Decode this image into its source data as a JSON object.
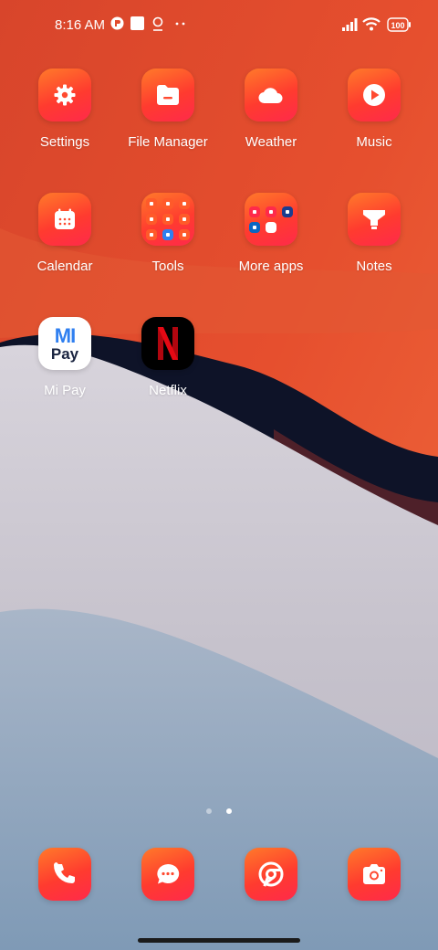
{
  "status_bar": {
    "time": "8:16 AM",
    "battery": "100",
    "icons": [
      "app-notification-icon",
      "square-notification-icon",
      "location-icon",
      "more-dots-icon",
      "signal-icon",
      "wifi-icon",
      "battery-icon"
    ]
  },
  "apps": [
    {
      "label": "Settings",
      "icon": "gear-icon"
    },
    {
      "label": "File Manager",
      "icon": "folder-icon"
    },
    {
      "label": "Weather",
      "icon": "cloud-icon"
    },
    {
      "label": "Music",
      "icon": "play-icon"
    },
    {
      "label": "Calendar",
      "icon": "calendar-icon"
    },
    {
      "label": "Tools",
      "icon": "tools-folder-icon"
    },
    {
      "label": "More apps",
      "icon": "more-apps-folder-icon"
    },
    {
      "label": "Notes",
      "icon": "notes-icon"
    },
    {
      "label": "Mi Pay",
      "icon": "mipay-icon",
      "icon_text": "Pay",
      "icon_top": "MI"
    },
    {
      "label": "Netflix",
      "icon": "netflix-icon",
      "icon_text": "N"
    }
  ],
  "page_indicator": {
    "count": 2,
    "active": 2
  },
  "dock": [
    {
      "icon": "phone-icon"
    },
    {
      "icon": "messages-icon"
    },
    {
      "icon": "chrome-icon"
    },
    {
      "icon": "camera-icon"
    }
  ],
  "colors": {
    "app_icon_gradient_start": "#ff7a2a",
    "app_icon_gradient_end": "#ff2a4a",
    "wallpaper_top": "#e4502e",
    "wallpaper_dark_band": "#0d1226",
    "wallpaper_light": "#c9c6d0",
    "wallpaper_bottom": "#8fa6bf"
  }
}
